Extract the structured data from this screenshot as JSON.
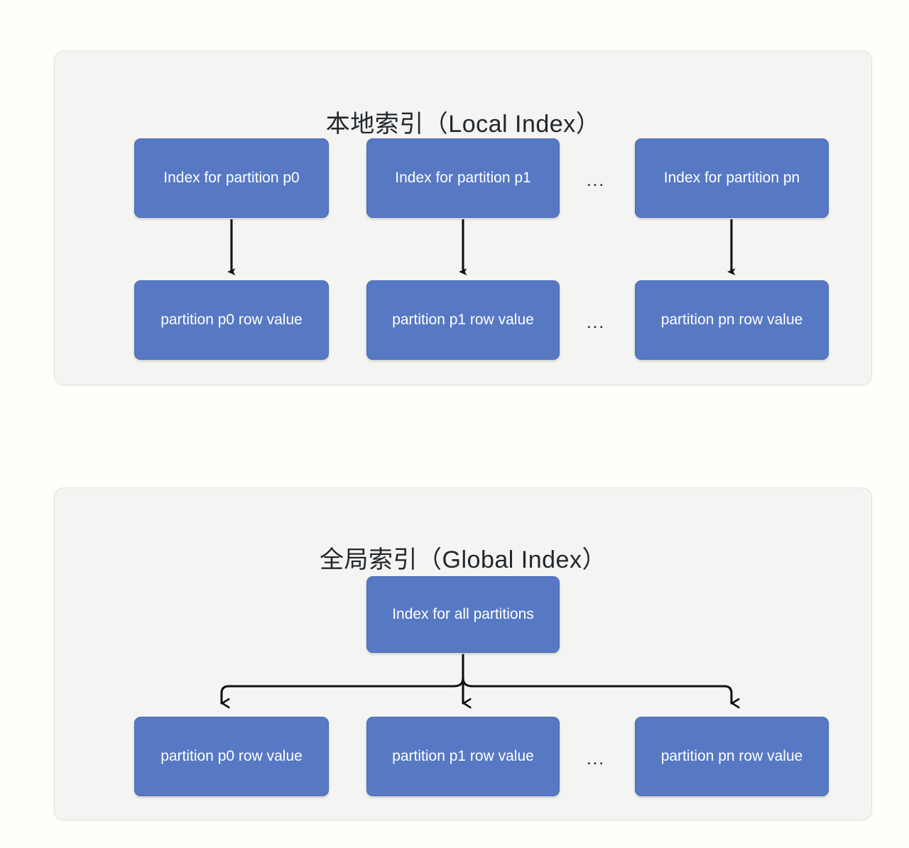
{
  "page": {
    "background_color": "#fffffa",
    "panel_background": "#f4f4f2",
    "panel_border": "#e2e2e2",
    "node_fill": "#5779c4",
    "node_border": "#4a6bb5",
    "node_text_color": "#ffffff",
    "connector_color": "#111111",
    "title_color": "#22272e"
  },
  "panels": [
    {
      "id": "local",
      "title": "本地索引（Local Index）",
      "index_row": [
        {
          "label": "Index for partition p0"
        },
        {
          "label": "Index for partition p1"
        },
        {
          "label": "Index for partition pn"
        }
      ],
      "value_row": [
        {
          "label": "partition p0 row value"
        },
        {
          "label": "partition p1 row value"
        },
        {
          "label": "partition pn row value"
        }
      ],
      "ellipsis_top": "...",
      "ellipsis_bottom": "..."
    },
    {
      "id": "global",
      "title": "全局索引（Global Index）",
      "index_node": {
        "label": "Index for all partitions"
      },
      "value_row": [
        {
          "label": "partition p0 row value"
        },
        {
          "label": "partition p1 row value"
        },
        {
          "label": "partition pn row value"
        }
      ],
      "ellipsis_bottom": "..."
    }
  ]
}
